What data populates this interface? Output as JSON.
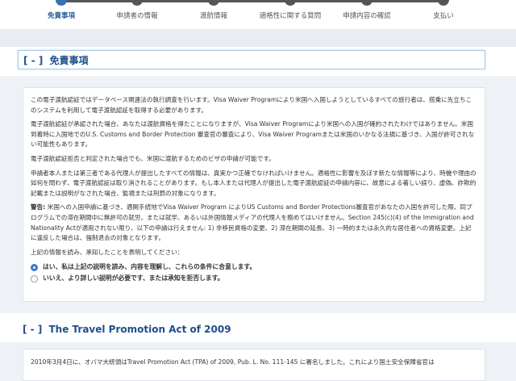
{
  "steps": [
    {
      "label": "免責事項",
      "active": true
    },
    {
      "label": "申請者の情報",
      "active": false
    },
    {
      "label": "渡航情報",
      "active": false
    },
    {
      "label": "適格性に関する質問",
      "active": false
    },
    {
      "label": "申請内容の確認",
      "active": false
    },
    {
      "label": "支払い",
      "active": false
    }
  ],
  "disclaimer": {
    "toggle": "[ - ]",
    "title": "免責事項",
    "p1": "この電子渡航認証ではデータベース関連法の執行調査を行います。Visa Waiver Programにより米国へ入国しようとしているすべての旅行者は、搭乗に先立ちこのシステムを利用して電子渡航認証を取得する必要があります。",
    "p2": "電子渡航認証が承認された場合、あなたは渡航資格を得たことになりますが、Visa Waiver Programにより米国への入国が確約されたわけではありません。米国到着時に入国地でのU.S. Customs and Border Protection 審査官の審査により、Visa Waiver Programまたは米国のいかなる法規に基づき、入国が許可されない可能性もあります。",
    "p3": "電子渡航認証拒否と判定された場合でも、米国に渡航するためのビザの申請が可能です。",
    "p4": "申請者本人または第三者である代理人が提出したすべての情報は、真実かつ正確でなければいけません。適格性に影響を及ぼす新たな情報等により、時機や理由の如何を問わず、電子渡航認証は取り消されることがあります。もし本人または代理人が提出した電子渡航認証の申請内容に、故意による著しい誤り、虚偽、詐欺的記載または説明がなされた場合、監視または刑罰の対象になります。",
    "warn_title": "警告:",
    "warn_text": " 米国への入国申請に基づき、適関手続地でVisa Waiver Program によりUS Customs and Border Protections審査官があなたの入国を許可した際、同プログラムでの滞在期間中に無許可の就労、または就学、あるいは外国情報メディアの代理人を務めてはいけません。Section 245(c)(4) of the Immigration and Nationality Actが適用されない限り、以下の申請は行えません: 1) 非移民資格の変更、2) 滞在期間の延長、3) 一時的または永久的な居住者への資格変更。上記に違反した場合は、強制退去の対象となります。",
    "prompt": "上記の情報を読み、承知したことを表明してください：",
    "option_yes": "はい、私は上記の説明を読み、内容を理解し、これらの条件に合意します。",
    "option_no": "いいえ、より詳しい説明が必要です、または承知を拒否します。"
  },
  "travel": {
    "toggle": "[ - ]",
    "title": "The Travel Promotion Act of 2009",
    "text": "2010年3月4日に、オバマ大統領はTravel Promotion Act (TPA) of 2009, Pub. L. No. 111-145 に署名しました。これにより国土安全保障省官は"
  }
}
